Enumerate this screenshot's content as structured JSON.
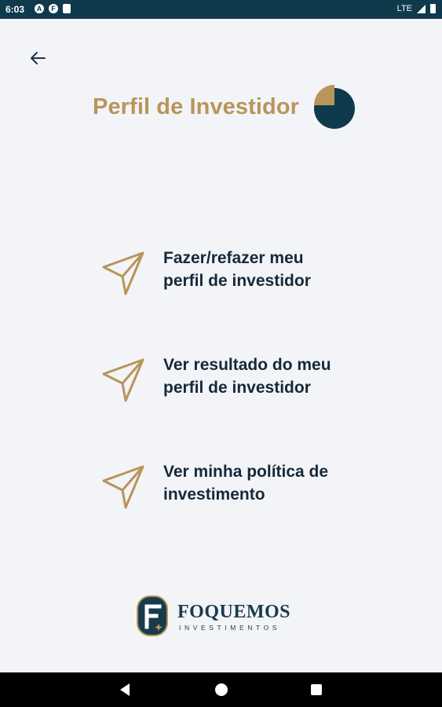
{
  "status_bar": {
    "time": "6:03",
    "network": "LTE",
    "icons_left": [
      "android-icon",
      "f-app-icon",
      "sd-card-icon"
    ]
  },
  "header": {
    "back_icon": "arrow-left-icon",
    "title": "Perfil de Investidor",
    "title_icon": "pie-chart-icon"
  },
  "menu": {
    "items": [
      {
        "label": "Fazer/refazer meu\nperfil de investidor",
        "icon": "send-icon"
      },
      {
        "label": "Ver resultado do meu\nperfil de investidor",
        "icon": "send-icon"
      },
      {
        "label": "Ver minha política de\ninvestimento",
        "icon": "send-icon"
      }
    ]
  },
  "brand": {
    "name": "FOQUEMOS",
    "subtitle": "INVESTIMENTOS"
  },
  "colors": {
    "accent_gold": "#b8955a",
    "dark_navy": "#0e3a4c",
    "text": "#16293a",
    "background": "#f3f4f8"
  },
  "nav_bar": {
    "icons": [
      "nav-back-icon",
      "nav-home-icon",
      "nav-recents-icon"
    ]
  }
}
